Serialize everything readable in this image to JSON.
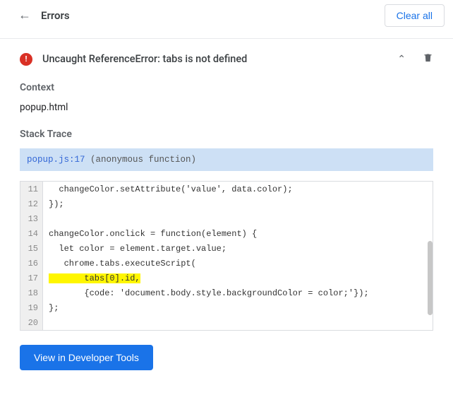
{
  "header": {
    "title": "Errors",
    "clear_label": "Clear all"
  },
  "error": {
    "message": "Uncaught ReferenceError: tabs is not defined"
  },
  "sections": {
    "context_h": "Context",
    "context_file": "popup.html",
    "stack_h": "Stack Trace"
  },
  "frame": {
    "location": "popup.js:17",
    "fn": "(anonymous function)"
  },
  "code": {
    "highlight_line": 17,
    "lines": [
      {
        "n": 11,
        "t": "  changeColor.setAttribute('value', data.color);"
      },
      {
        "n": 12,
        "t": "});"
      },
      {
        "n": 13,
        "t": ""
      },
      {
        "n": 14,
        "t": "changeColor.onclick = function(element) {"
      },
      {
        "n": 15,
        "t": "  let color = element.target.value;"
      },
      {
        "n": 16,
        "t": "   chrome.tabs.executeScript("
      },
      {
        "n": 17,
        "t": "       tabs[0].id,"
      },
      {
        "n": 18,
        "t": "       {code: 'document.body.style.backgroundColor = color;'});"
      },
      {
        "n": 19,
        "t": "};"
      },
      {
        "n": 20,
        "t": ""
      }
    ]
  },
  "footer": {
    "view_btn": "View in Developer Tools"
  }
}
